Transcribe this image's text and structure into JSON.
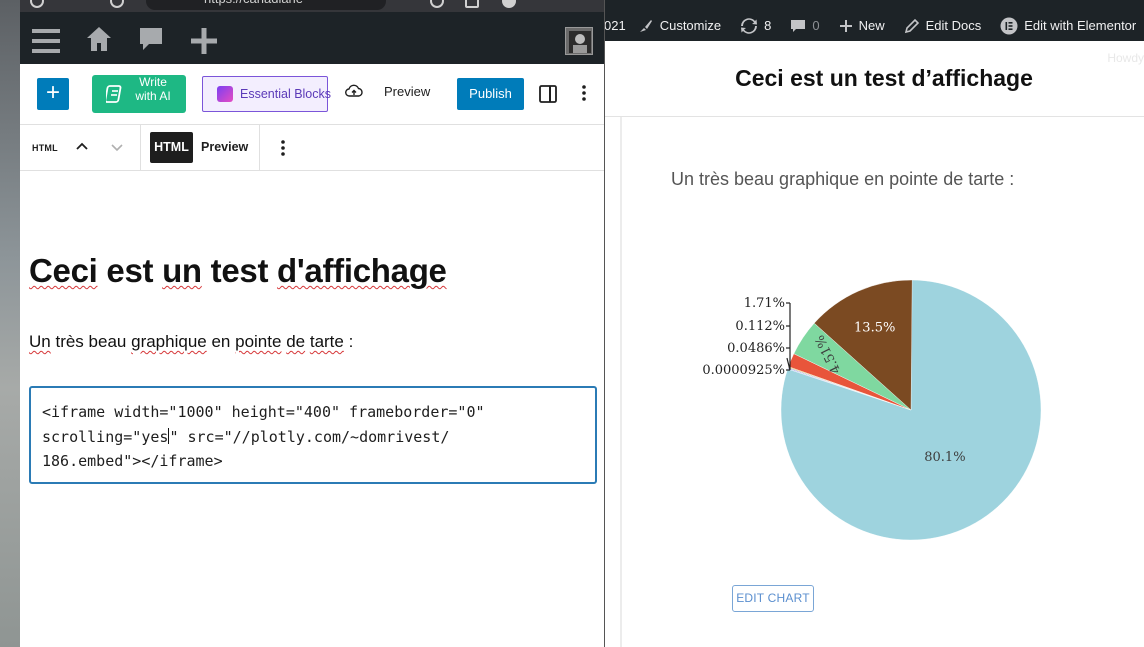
{
  "browser": {
    "url_fragment": "https://canadiane"
  },
  "admin_bar": {
    "year_fragment": "021",
    "customize": "Customize",
    "updates_count": "8",
    "comments_count": "0",
    "new": "New",
    "edit_docs": "Edit Docs",
    "edit_elementor": "Edit with Elementor",
    "howdy": "Howdy"
  },
  "front": {
    "title": "Ceci est un test d’affichage",
    "description": "Un très beau graphique en pointe de tarte :",
    "edit_chart": "EDIT CHART"
  },
  "editor": {
    "toolbar": {
      "add_label": "+",
      "write_ai": "Write with AI",
      "essential_blocks": "Essential Blocks",
      "preview": "Preview",
      "publish": "Publish"
    },
    "block_toolbar": {
      "block_type": "HTML",
      "html_tab": "HTML",
      "preview_tab": "Preview"
    },
    "post_title_words": [
      "Ceci",
      "est",
      "un",
      "test",
      "d'affichage"
    ],
    "paragraph_words": [
      "Un",
      "très",
      "beau",
      "graphique",
      "en",
      "pointe",
      "de",
      "tarte",
      ":"
    ],
    "code": {
      "line1": "<iframe width=\"1000\" height=\"400\" frameborder=\"0\"",
      "line2_a": "scrolling=\"yes",
      "line2_b": "\" src=\"//plotly.com/~domrivest/",
      "line3": "186.embed\"></iframe>"
    }
  },
  "chart_data": {
    "type": "pie",
    "slices": [
      {
        "label": "80.1%",
        "value": 80.1,
        "color": "#9ed3de"
      },
      {
        "label": "0.0000925%",
        "value": 9.25e-05,
        "color": "#8fb3ef"
      },
      {
        "label": "0.0486%",
        "value": 0.0486,
        "color": "#7f5cd9"
      },
      {
        "label": "0.112%",
        "value": 0.112,
        "color": "#d6c94a"
      },
      {
        "label": "1.71%",
        "value": 1.71,
        "color": "#e8553b"
      },
      {
        "label": "4.51%",
        "value": 4.51,
        "color": "#7fd8a0"
      },
      {
        "label": "13.5%",
        "value": 13.5,
        "color": "#7b4a22"
      }
    ],
    "outside_labels": [
      "1.71%",
      "0.112%",
      "0.0486%",
      "0.0000925%"
    ],
    "inside_labels": [
      "80.1%",
      "13.5%",
      "4.51%"
    ]
  }
}
